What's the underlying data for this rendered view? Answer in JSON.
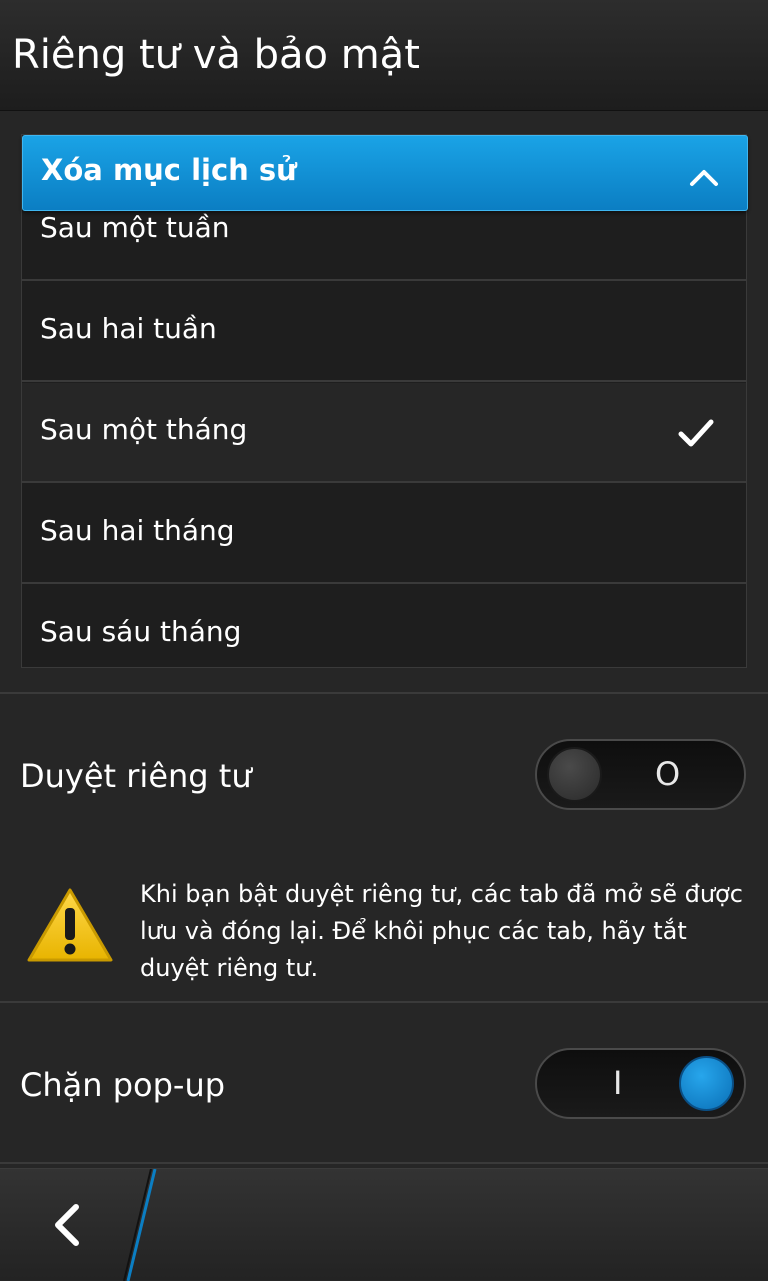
{
  "header": {
    "title": "Riêng tư và bảo mật"
  },
  "history_dropdown": {
    "label": "Xóa mục lịch sử",
    "options": [
      {
        "label": "Sau một tuần",
        "selected": false
      },
      {
        "label": "Sau hai tuần",
        "selected": false
      },
      {
        "label": "Sau một tháng",
        "selected": true
      },
      {
        "label": "Sau hai tháng",
        "selected": false
      },
      {
        "label": "Sau sáu tháng",
        "selected": false
      }
    ]
  },
  "private_browsing": {
    "label": "Duyệt riêng tư",
    "toggle_mark": "O",
    "enabled": false,
    "warning": "Khi bạn bật duyệt riêng tư, các tab đã mở sẽ được lưu và đóng lại. Để khôi phục các tab, hãy tắt duyệt riêng tư."
  },
  "popup_block": {
    "label": "Chặn pop-up",
    "toggle_mark": "I",
    "enabled": true
  },
  "icons": {
    "dropdown": "chevron-up-icon",
    "selected": "checkmark-icon",
    "warning": "warning-triangle-icon",
    "back": "back-chevron-icon"
  },
  "colors": {
    "accent_blue": "#0b7ec3",
    "warning_yellow": "#f5c400",
    "background": "#262626"
  }
}
